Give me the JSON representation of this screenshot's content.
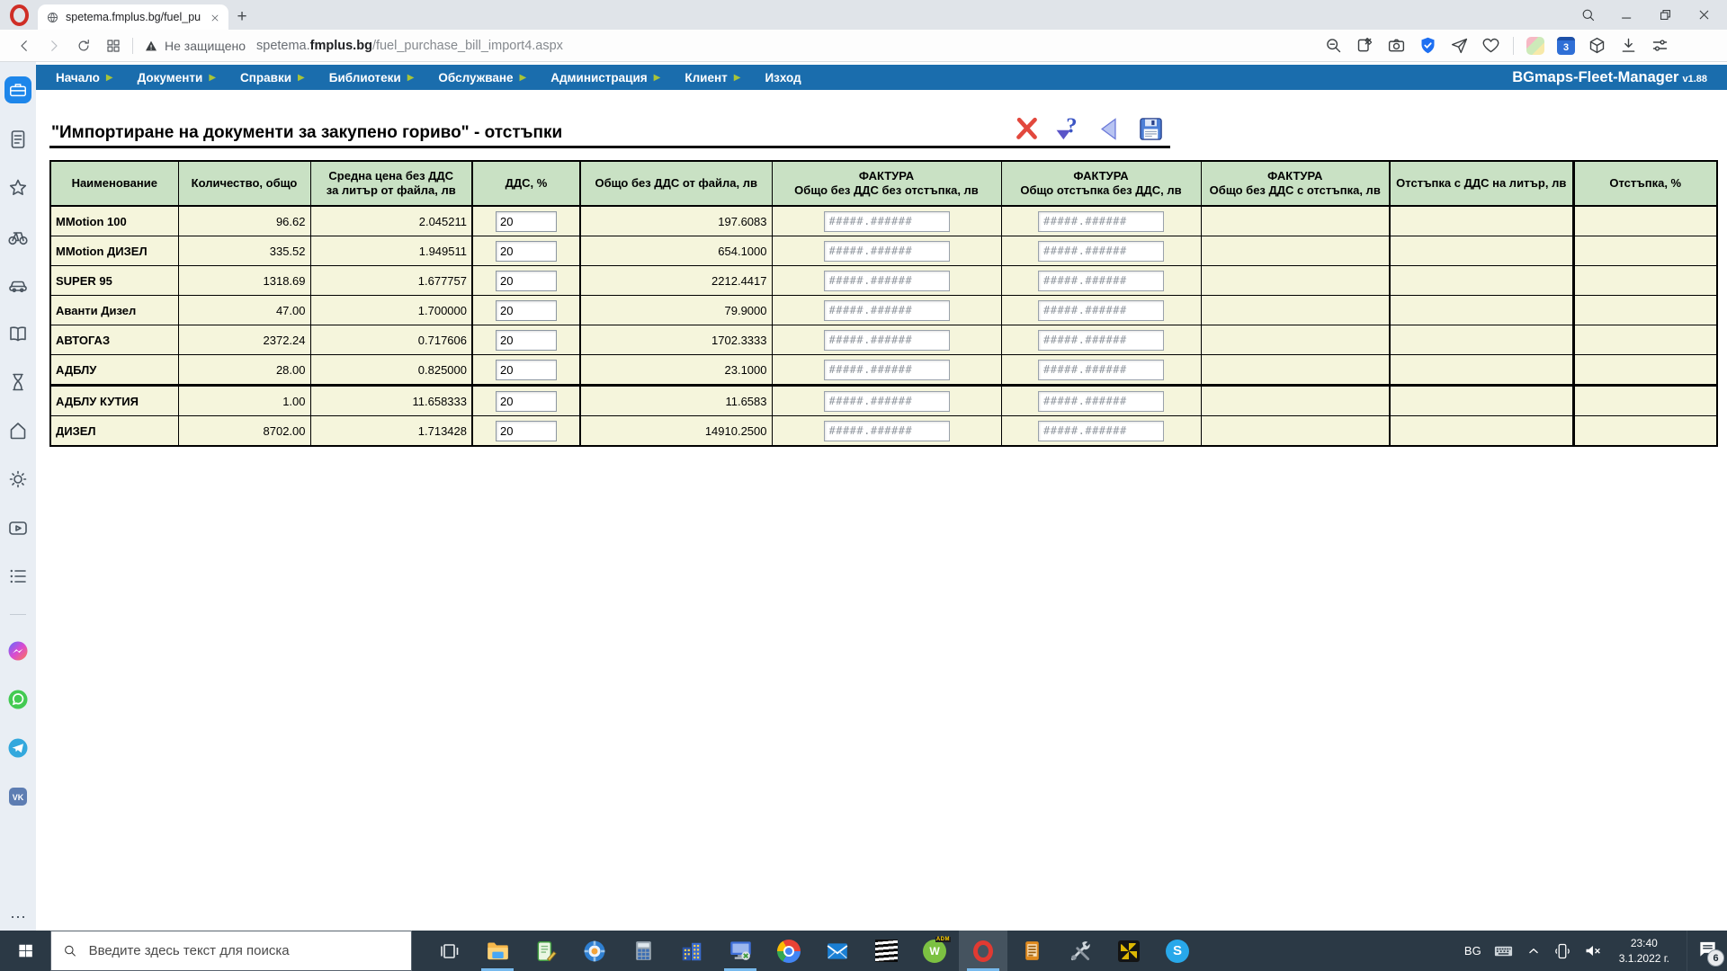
{
  "browser": {
    "tab": {
      "title": "spetema.fmplus.bg/fuel_pu"
    },
    "new_tab": "+",
    "security_label": "Не защищено",
    "url_prefix": "spetema.",
    "url_domain": "fmplus.bg",
    "url_path": "/fuel_purchase_bill_import4.aspx",
    "nav_buttons": [
      "back",
      "forward",
      "reload",
      "speed-dial"
    ],
    "address_icons": [
      "zoom-out",
      "bookmark-pin",
      "snapshot-camera",
      "vpn-shield",
      "send-flow",
      "favorites-heart",
      "separator",
      "pinboard-cube",
      "calendar",
      "extensions-box",
      "downloads",
      "easy-setup-sliders"
    ],
    "calendar_badge": "3",
    "window_controls": [
      "window-search",
      "window-minimize",
      "window-restore",
      "window-close"
    ]
  },
  "app": {
    "menu": [
      {
        "id": "nachalo",
        "label": "Начало"
      },
      {
        "id": "dokumenti",
        "label": "Документи"
      },
      {
        "id": "spravki",
        "label": "Справки"
      },
      {
        "id": "biblioteki",
        "label": "Библиотеки"
      },
      {
        "id": "obsluzhvane",
        "label": "Обслужване"
      },
      {
        "id": "administratsia",
        "label": "Администрация"
      },
      {
        "id": "klient",
        "label": "Клиент"
      },
      {
        "id": "izhod",
        "label": "Изход",
        "arrow": false
      }
    ],
    "brand": "BGmaps-Fleet-Manager",
    "version": "v1.88",
    "title": "\"Импортиране на документи за закупено гориво\" - отстъпки",
    "actions": [
      {
        "id": "cancel",
        "icon": "action-cancel"
      },
      {
        "id": "help",
        "icon": "action-help"
      },
      {
        "id": "back",
        "icon": "action-back"
      },
      {
        "id": "save",
        "icon": "action-save"
      }
    ]
  },
  "table": {
    "headers": [
      {
        "lines": [
          "Наименование"
        ]
      },
      {
        "lines": [
          "Количество, общо"
        ]
      },
      {
        "lines": [
          "Средна цена без ДДС",
          "за литър от файла, лв"
        ]
      },
      {
        "lines": [
          "ДДС, %"
        ]
      },
      {
        "lines": [
          "Общо без ДДС от файла, лв"
        ]
      },
      {
        "lines": [
          "ФАКТУРА",
          "Общо без ДДС без отстъпка, лв"
        ]
      },
      {
        "lines": [
          "ФАКТУРА",
          "Общо отстъпка без ДДС, лв"
        ]
      },
      {
        "lines": [
          "ФАКТУРА",
          "Общо без ДДС с отстъпка, лв"
        ]
      },
      {
        "lines": [
          "Отстъпка с ДДС на литър, лв"
        ]
      },
      {
        "lines": [
          "Отстъпка, %"
        ]
      }
    ],
    "invoice_placeholder": "#####.######",
    "rows": [
      {
        "name": "MMotion 100",
        "qty": "96.62",
        "price": "2.045211",
        "vat": "20",
        "total": "197.6083"
      },
      {
        "name": "MMotion ДИЗЕЛ",
        "qty": "335.52",
        "price": "1.949511",
        "vat": "20",
        "total": "654.1000"
      },
      {
        "name": "SUPER 95",
        "qty": "1318.69",
        "price": "1.677757",
        "vat": "20",
        "total": "2212.4417"
      },
      {
        "name": "Аванти Дизел",
        "qty": "47.00",
        "price": "1.700000",
        "vat": "20",
        "total": "79.9000"
      },
      {
        "name": "АВТОГАЗ",
        "qty": "2372.24",
        "price": "0.717606",
        "vat": "20",
        "total": "1702.3333"
      },
      {
        "name": "АДБЛУ",
        "qty": "28.00",
        "price": "0.825000",
        "vat": "20",
        "total": "23.1000"
      },
      {
        "name": "АДБЛУ КУТИЯ",
        "qty": "1.00",
        "price": "11.658333",
        "vat": "20",
        "total": "11.6583",
        "thick_top": true
      },
      {
        "name": "ДИЗЕЛ",
        "qty": "8702.00",
        "price": "1.713428",
        "vat": "20",
        "total": "14910.2500"
      }
    ]
  },
  "sidebar": {
    "items": [
      {
        "name": "workspace-briefcase",
        "active": true
      },
      {
        "name": "document"
      },
      {
        "name": "star"
      },
      {
        "name": "bicycle"
      },
      {
        "name": "car"
      },
      {
        "name": "book"
      },
      {
        "name": "hourglass"
      },
      {
        "name": "home"
      },
      {
        "name": "brightness-sun"
      },
      {
        "name": "video-popout"
      },
      {
        "name": "playlist"
      },
      {
        "name": "divider"
      },
      {
        "name": "messenger"
      },
      {
        "name": "whatsapp"
      },
      {
        "name": "telegram"
      },
      {
        "name": "vk"
      }
    ],
    "more": "⋯"
  },
  "taskbar": {
    "search_placeholder": "Введите здесь текст для поиска",
    "apps": [
      {
        "name": "task-view"
      },
      {
        "name": "file-explorer",
        "active": true
      },
      {
        "name": "notes"
      },
      {
        "name": "compass"
      },
      {
        "name": "calculator"
      },
      {
        "name": "buildings"
      },
      {
        "name": "remote-desktop",
        "active": true
      },
      {
        "name": "chrome"
      },
      {
        "name": "mail"
      },
      {
        "name": "zebra"
      },
      {
        "name": "adm"
      },
      {
        "name": "opera",
        "active": true,
        "highlight": true
      },
      {
        "name": "device"
      },
      {
        "name": "tools"
      },
      {
        "name": "service-tool"
      },
      {
        "name": "skype"
      }
    ],
    "tray": {
      "lang": "BG",
      "time": "23:40",
      "date": "3.1.2022 г.",
      "notification_count": "6"
    }
  }
}
